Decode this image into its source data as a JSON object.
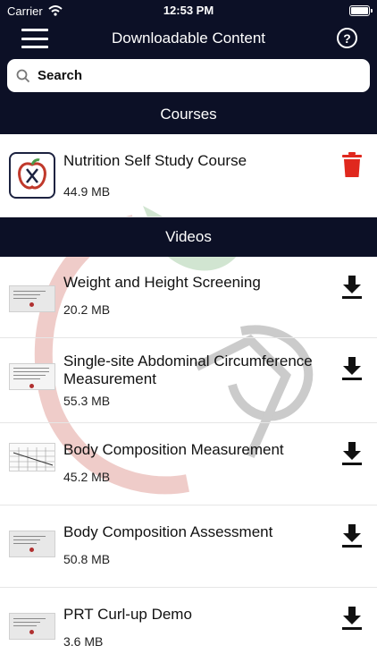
{
  "status": {
    "carrier": "Carrier",
    "time": "12:53 PM"
  },
  "nav": {
    "title": "Downloadable Content",
    "help_glyph": "?"
  },
  "search": {
    "placeholder": "Search"
  },
  "sections": {
    "courses": "Courses",
    "videos": "Videos"
  },
  "courses": [
    {
      "title": "Nutrition Self Study Course",
      "size": "44.9 MB",
      "action_icon": "trash-icon"
    }
  ],
  "videos": [
    {
      "title": "Weight and Height Screening",
      "size": "20.2 MB",
      "action_icon": "download-icon"
    },
    {
      "title": "Single-site Abdominal Circumference Measurement",
      "size": "55.3 MB",
      "action_icon": "download-icon"
    },
    {
      "title": "Body Composition Measurement",
      "size": "45.2 MB",
      "action_icon": "download-icon"
    },
    {
      "title": "Body Composition Assessment",
      "size": "50.8 MB",
      "action_icon": "download-icon"
    },
    {
      "title": "PRT Curl-up Demo",
      "size": "3.6 MB",
      "action_icon": "download-icon"
    }
  ],
  "colors": {
    "navbar": "#0c1026",
    "trash": "#e0281e",
    "watermark_red": "#c0392b",
    "watermark_green": "#4a9a4a"
  }
}
